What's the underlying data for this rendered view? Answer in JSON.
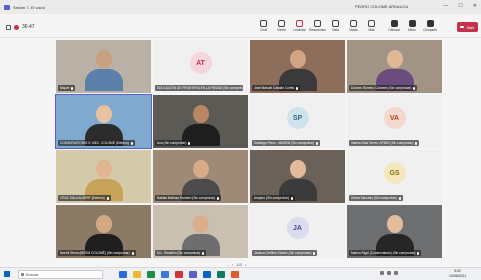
{
  "window": {
    "app_title": "Sesión 7. El vacío",
    "center_title": "PEDRO COLOMÉ ARDAUCA",
    "min": "—",
    "max": "☐",
    "close": "✕"
  },
  "call": {
    "timer": "36:47",
    "toolbar": [
      {
        "label": "Chat",
        "icon": "chat-icon"
      },
      {
        "label": "Gente",
        "icon": "people-icon"
      },
      {
        "label": "Levantar",
        "icon": "raise-hand-icon"
      },
      {
        "label": "Reacciones",
        "icon": "reactions-icon"
      },
      {
        "label": "Vista",
        "icon": "view-icon"
      },
      {
        "label": "Notas",
        "icon": "notes-icon"
      },
      {
        "label": "Más",
        "icon": "more-icon"
      }
    ],
    "media": [
      {
        "label": "Cámara",
        "icon": "camera-icon"
      },
      {
        "label": "Micro",
        "icon": "mic-icon"
      },
      {
        "label": "Compartir",
        "icon": "share-icon"
      }
    ],
    "leave_label": "Salir"
  },
  "participants": [
    {
      "name": "Miquel",
      "initials": "",
      "photo": true,
      "skin": "#c9a07f",
      "shirt": "#5a7fa8",
      "bg": "#b9b1a6"
    },
    {
      "name": "EDUCACIÓN DE FRONTERA EN LA PIEDAD (Sin comprobar)",
      "initials": "AT",
      "photo": false,
      "color": "#c4314b",
      "circle": "#f6d6dc"
    },
    {
      "name": "José Manuel Catalán Cortés",
      "initials": "",
      "photo": true,
      "skin": "#d2a484",
      "shirt": "#3a3a3a",
      "bg": "#8c6e5a"
    },
    {
      "name": "Dolores Romero Colomés (Sin comprobar)",
      "initials": "",
      "photo": true,
      "skin": "#e0b896",
      "shirt": "#6a4d7e",
      "bg": "#a19485"
    },
    {
      "name": "CONSERVATORIO S. MEC. COLOMÉ (Externo)",
      "initials": "",
      "photo": true,
      "skin": "#e8c1a0",
      "shirt": "#2b2b2b",
      "bg": "#7fa9cf",
      "active": true
    },
    {
      "name": "Ana (Sin comprobar)",
      "initials": "",
      "photo": true,
      "skin": "#b98863",
      "shirt": "#1e1e1e",
      "bg": "#5b5a54"
    },
    {
      "name": "Santiago Pérez - MASEM (Sin comprobar)",
      "initials": "SP",
      "photo": false,
      "color": "#2f6b8a",
      "circle": "#cfe3ec"
    },
    {
      "name": "Valeria Díaz Torres, APIMO (Sin comprobar)",
      "initials": "VA",
      "photo": false,
      "color": "#b0451d",
      "circle": "#f3d9cd"
    },
    {
      "name": "CRUZ SALA ALBERT (Externo)",
      "initials": "",
      "photo": true,
      "skin": "#e1b592",
      "shirt": "#c9a259",
      "bg": "#d4c9a8"
    },
    {
      "name": "Natalia Mañosa Romero (Sin comprobar)",
      "initials": "",
      "photo": true,
      "skin": "#d9aa86",
      "shirt": "#4c4c4c",
      "bg": "#9e8a77"
    },
    {
      "name": "Amparo (Sin comprobar)",
      "initials": "",
      "photo": true,
      "skin": "#e3bb99",
      "shirt": "#3b3b3b",
      "bg": "#6a6259"
    },
    {
      "name": "Gema Sánchez (Sin comprobar)",
      "initials": "GS",
      "photo": false,
      "color": "#8a6d00",
      "circle": "#f3e7bd"
    },
    {
      "name": "Noemi Sierra (MEEM COLOMÉ) (Sin comprobar)",
      "initials": "",
      "photo": true,
      "skin": "#d5a985",
      "shirt": "#1f1f1f",
      "bg": "#8b7a66"
    },
    {
      "name": "M.L. Rosallón (Sin comprobar)",
      "initials": "",
      "photo": true,
      "skin": "#dcae8b",
      "shirt": "#6e6e6e",
      "bg": "#c9c0b2"
    },
    {
      "name": "Jessica Grefiles Gómez (Sin comprobar)",
      "initials": "JA",
      "photo": false,
      "color": "#4a4a8a",
      "circle": "#dcdcf0"
    },
    {
      "name": "Marina Rigol (Conservatorio) (Sin comprobar)",
      "initials": "",
      "photo": true,
      "skin": "#e4bd9c",
      "shirt": "#262626",
      "bg": "#6d6f70"
    }
  ],
  "pager": {
    "prev": "‹",
    "text": "1/3",
    "next": "›"
  },
  "taskbar": {
    "search_placeholder": "Buscar",
    "apps": [
      "#2e6bd6",
      "#f2b630",
      "#1d8f43",
      "#3c78d8",
      "#d13438",
      "#5b5fc7",
      "#0a64c8",
      "#0f7b5f",
      "#e35a26"
    ],
    "time": "9:02",
    "date": "10/06/2021"
  }
}
